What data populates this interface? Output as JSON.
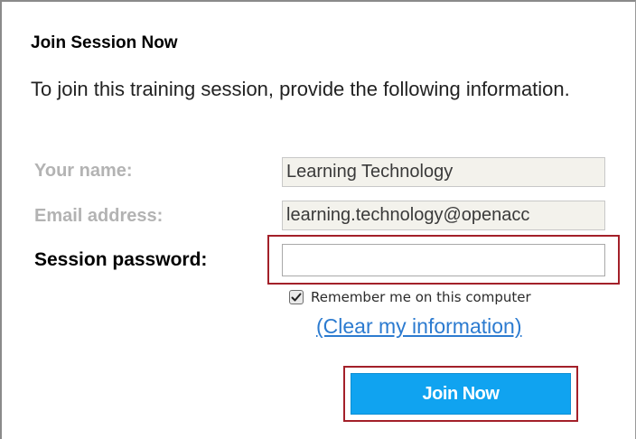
{
  "dialog": {
    "title": "Join Session Now",
    "intro": "To join this training session, provide the following information."
  },
  "form": {
    "name_label": "Your name:",
    "name_value": "Learning Technology",
    "email_label": "Email address:",
    "email_value": "learning.technology@openacc",
    "password_label": "Session password:",
    "password_value": "",
    "remember_label": "Remember me on this computer",
    "remember_checked": true,
    "clear_link": "(Clear my information)",
    "submit_label": "Join Now"
  },
  "colors": {
    "highlight": "#a32029",
    "button_bg": "#10a3f0",
    "link": "#2c7bd0",
    "disabled_label": "#b3b3b3"
  }
}
